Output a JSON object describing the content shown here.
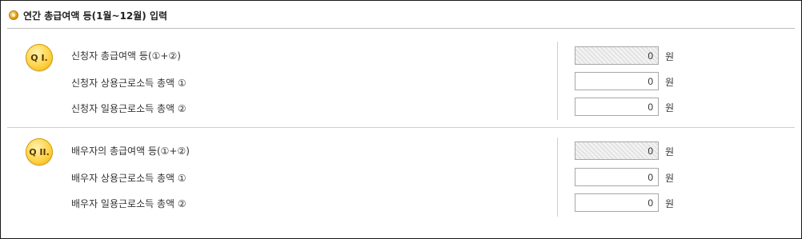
{
  "section": {
    "title": "연간 총급여액 등(1월~12월) 입력"
  },
  "groups": [
    {
      "badge": "Q I.",
      "rows": [
        {
          "label": "신청자 총급여액 등(①+②)",
          "value": "0",
          "unit": "원",
          "readonly": true
        },
        {
          "label": "신청자 상용근로소득 총액 ①",
          "value": "0",
          "unit": "원",
          "readonly": false
        },
        {
          "label": "신청자 일용근로소득 총액 ②",
          "value": "0",
          "unit": "원",
          "readonly": false
        }
      ]
    },
    {
      "badge": "Q II.",
      "rows": [
        {
          "label": "배우자의 총급여액 등(①+②)",
          "value": "0",
          "unit": "원",
          "readonly": true
        },
        {
          "label": "배우자 상용근로소득 총액 ①",
          "value": "0",
          "unit": "원",
          "readonly": false
        },
        {
          "label": "배우자 일용근로소득 총액 ②",
          "value": "0",
          "unit": "원",
          "readonly": false
        }
      ]
    }
  ]
}
